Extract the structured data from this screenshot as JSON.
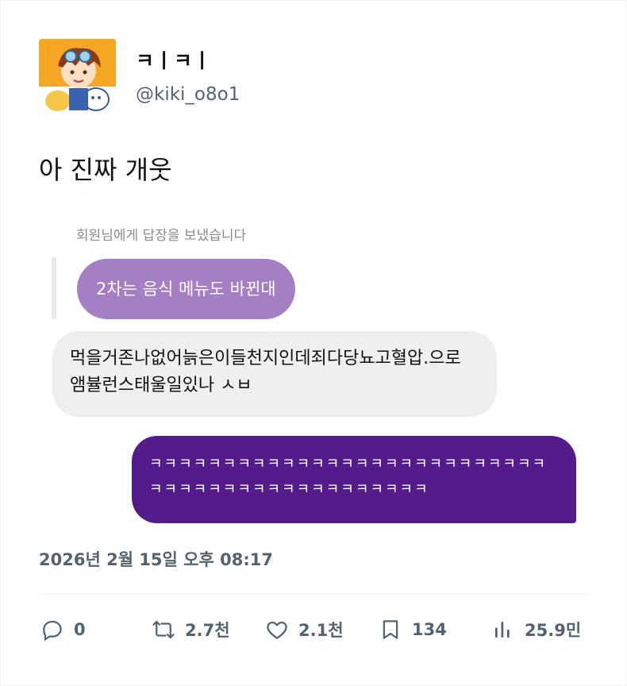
{
  "author": {
    "display_name": "ㅋㅣㅋㅣ",
    "handle": "@kiki_o8o1"
  },
  "tweet": {
    "text": "아 진짜 개웃"
  },
  "screenshot": {
    "dm_note": "회원님에게 답장을 보냈습니다",
    "quoted_message": "2차는 음식 메뉴도 바뀐대",
    "received_message": "먹을거존나없어늙은이들천지인데죄다당뇨고혈압.으로 앰뷸런스태울일있나 ㅅㅂ",
    "sent_message": "ㅋㅋㅋㅋㅋㅋㅋㅋㅋㅋㅋㅋㅋㅋㅋㅋㅋㅋㅋㅋㅋㅋㅋㅋㅋㅋㅋㅋㅋㅋㅋㅋㅋㅋㅋㅋㅋㅋㅋㅋㅋㅋㅋㅋㅋㅋ",
    "colors": {
      "quoted_bubble": "#a57fc3",
      "received_bubble": "#efefef",
      "sent_bubble": "#541b8a"
    }
  },
  "timestamp": "2026년 2월 15일 오후 08:17",
  "actions": {
    "reply": {
      "icon": "reply-icon",
      "count": "0"
    },
    "retweet": {
      "icon": "retweet-icon",
      "count": "2.7천"
    },
    "like": {
      "icon": "heart-icon",
      "count": "2.1천"
    },
    "bookmark": {
      "icon": "bookmark-icon",
      "count": "134"
    },
    "views": {
      "icon": "views-icon",
      "count": "25.9민"
    }
  }
}
